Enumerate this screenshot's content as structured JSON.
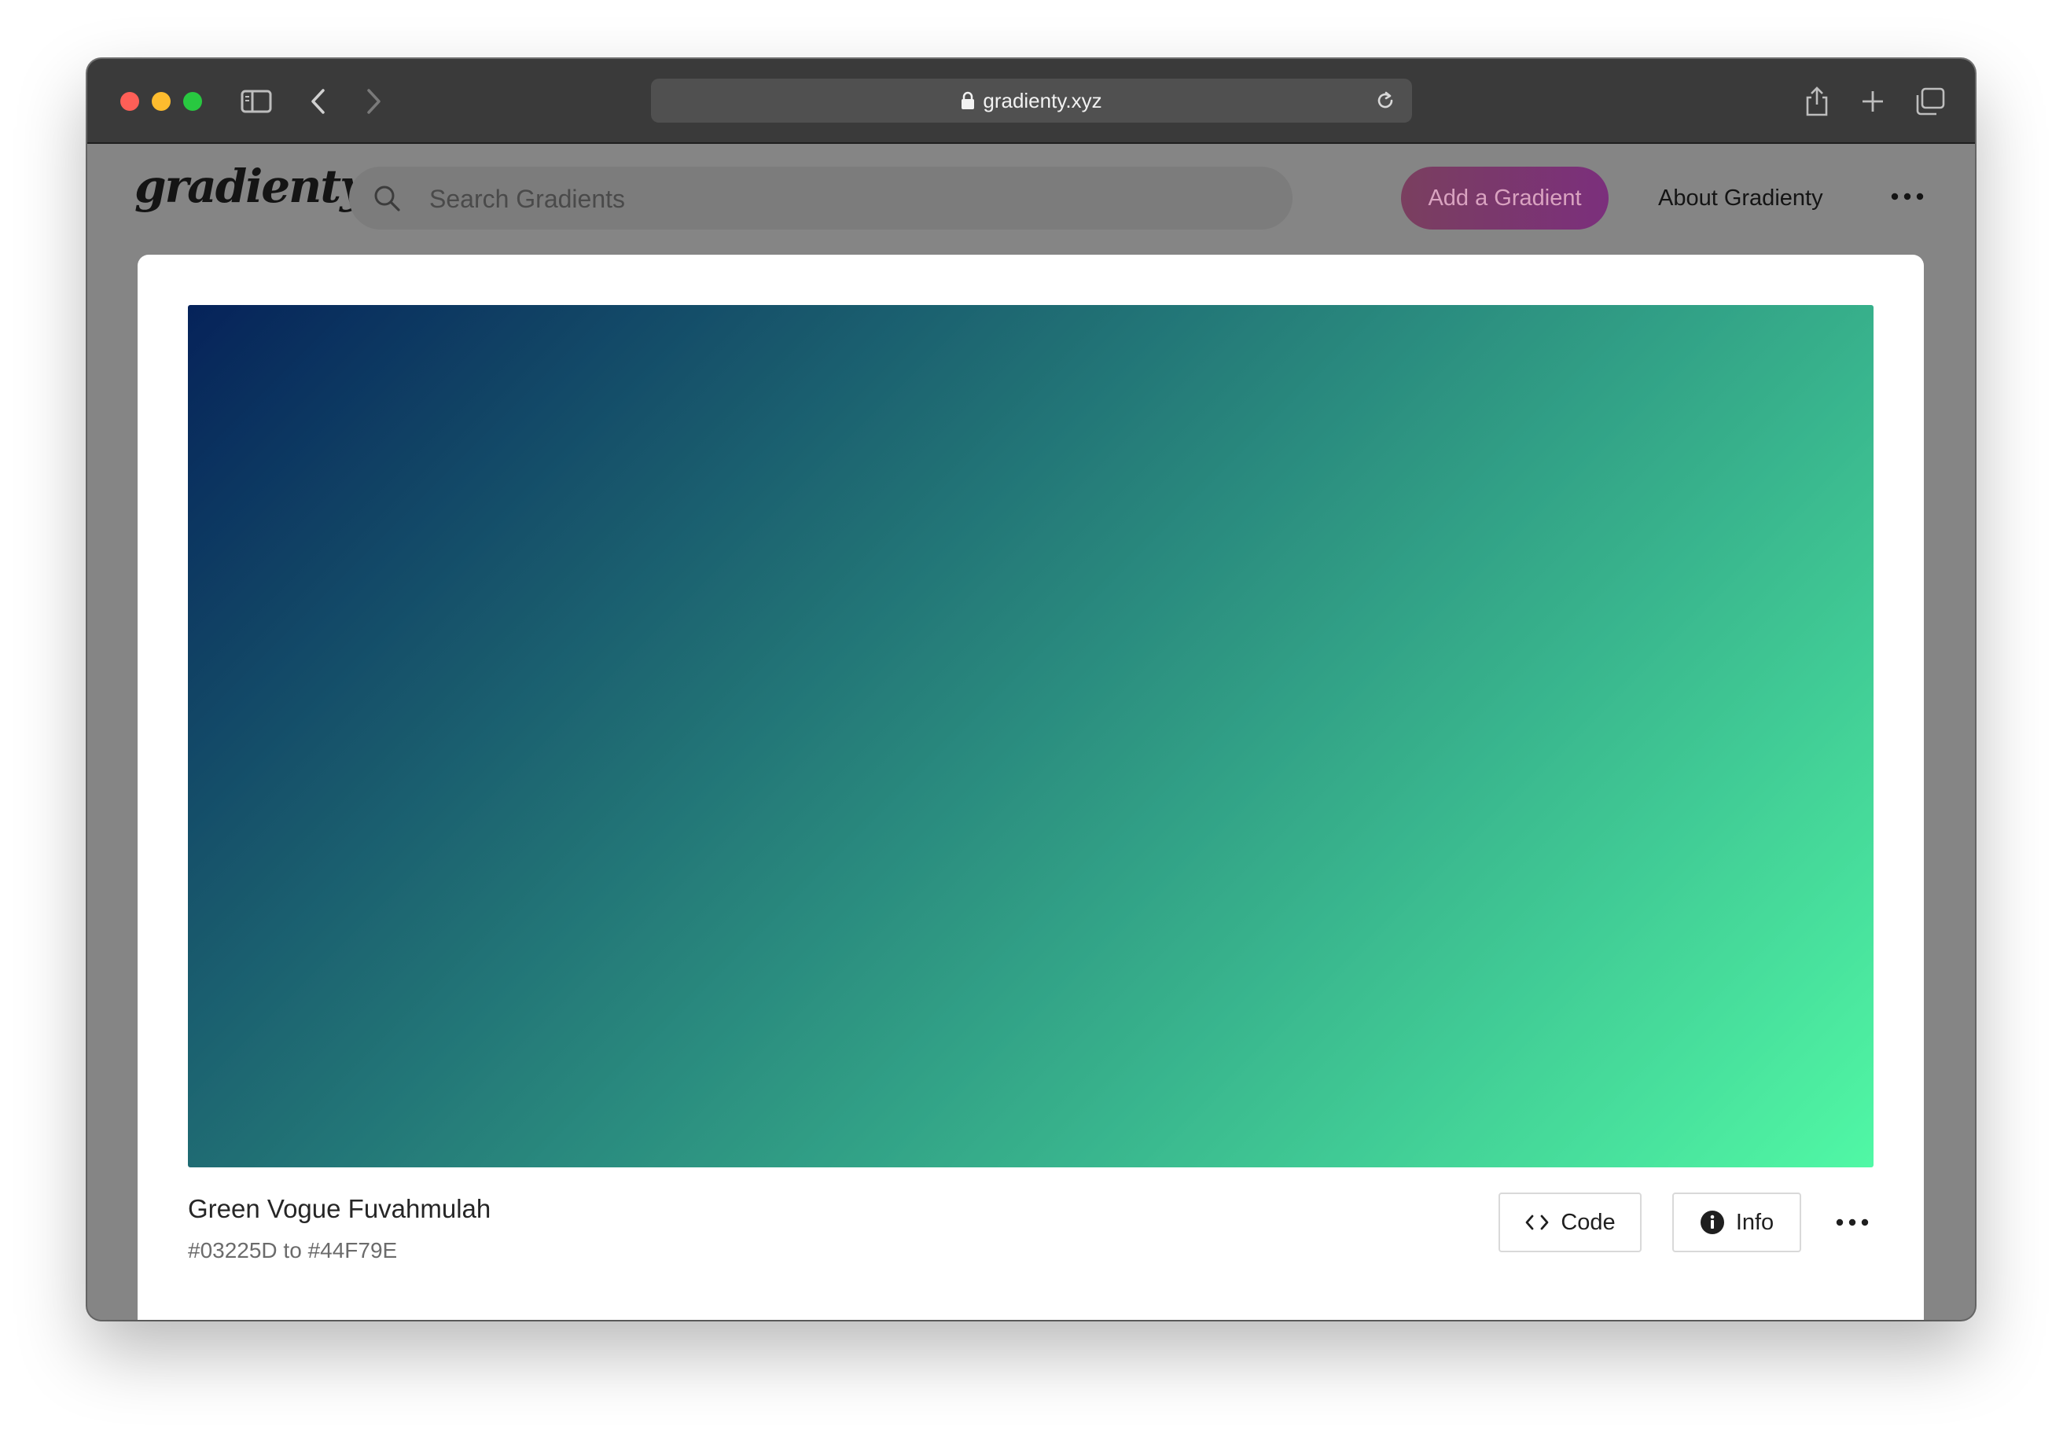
{
  "browser": {
    "url": "gradienty.xyz",
    "traffic_lights": [
      "close",
      "minimize",
      "zoom"
    ],
    "icons": [
      "sidebar-toggle-icon",
      "back-icon",
      "forward-icon",
      "lock-icon",
      "reload-icon",
      "share-icon",
      "new-tab-icon",
      "tab-overview-icon"
    ]
  },
  "header": {
    "logo": "gradienty",
    "search_placeholder": "Search Gradients",
    "search_value": "",
    "add_button": "Add a Gradient",
    "about_link": "About Gradienty",
    "more_icon": "more-horizontal-icon"
  },
  "gradient": {
    "name": "Green Vogue Fuvahmulah",
    "codes_text": "#03225D to #44F79E",
    "start_color": "#03225D",
    "end_color": "#44F79E",
    "code_button": "Code",
    "info_button": "Info"
  },
  "colors": {
    "add_button_start": "#7a3f5f",
    "add_button_end": "#7b2f7c"
  }
}
